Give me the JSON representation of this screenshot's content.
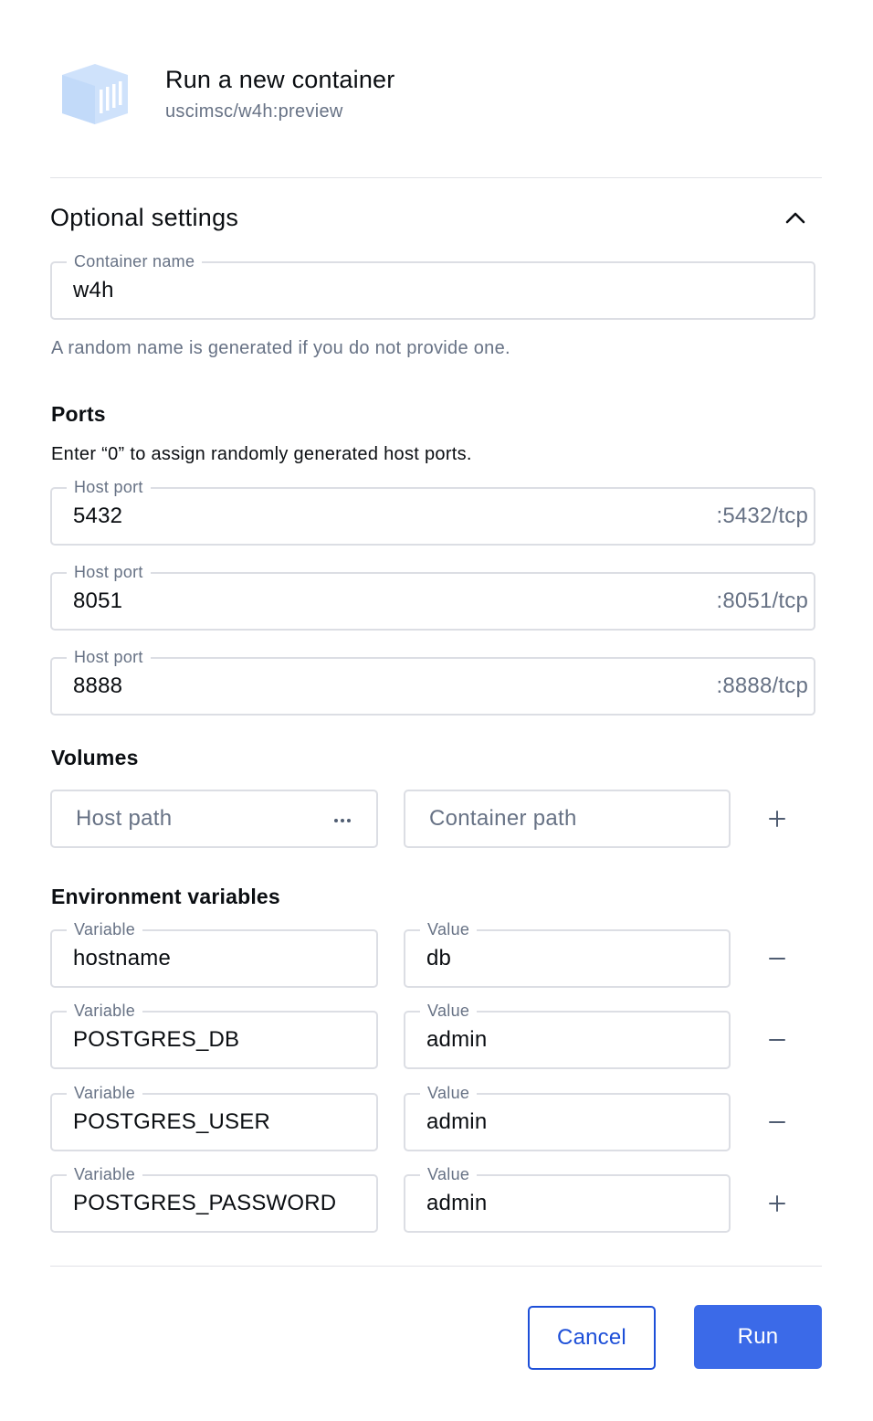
{
  "header": {
    "title": "Run a new container",
    "image": "uscimsc/w4h:preview",
    "icon": "container-icon"
  },
  "optional_settings": {
    "label": "Optional settings",
    "expanded": true,
    "toggle_icon": "chevron-up-icon"
  },
  "container_name": {
    "label": "Container name",
    "value": "w4h",
    "helper": "A random name is generated if you do not provide one."
  },
  "ports": {
    "heading": "Ports",
    "description": "Enter “0” to assign randomly generated host ports.",
    "rows": [
      {
        "label": "Host port",
        "value": "5432",
        "container_port": ":5432/tcp"
      },
      {
        "label": "Host port",
        "value": "8051",
        "container_port": ":8051/tcp"
      },
      {
        "label": "Host port",
        "value": "8888",
        "container_port": ":8888/tcp"
      }
    ]
  },
  "volumes": {
    "heading": "Volumes",
    "host_path_placeholder": "Host path",
    "container_path_placeholder": "Container path",
    "browse_icon": "more-horizontal-icon",
    "add_icon": "plus-icon"
  },
  "env": {
    "heading": "Environment variables",
    "variable_label": "Variable",
    "value_label": "Value",
    "rows": [
      {
        "variable": "hostname",
        "value": "db",
        "action": "minus-icon"
      },
      {
        "variable": "POSTGRES_DB",
        "value": "admin",
        "action": "minus-icon"
      },
      {
        "variable": "POSTGRES_USER",
        "value": "admin",
        "action": "minus-icon"
      },
      {
        "variable": "POSTGRES_PASSWORD",
        "value": "admin",
        "action": "plus-icon"
      }
    ]
  },
  "footer": {
    "cancel_label": "Cancel",
    "run_label": "Run"
  },
  "colors": {
    "primary": "#3b6ae8",
    "primary_dark": "#1d4fd8",
    "muted_text": "#677285",
    "border": "#dcdee4",
    "icon_fill": "#cfe2fb"
  }
}
